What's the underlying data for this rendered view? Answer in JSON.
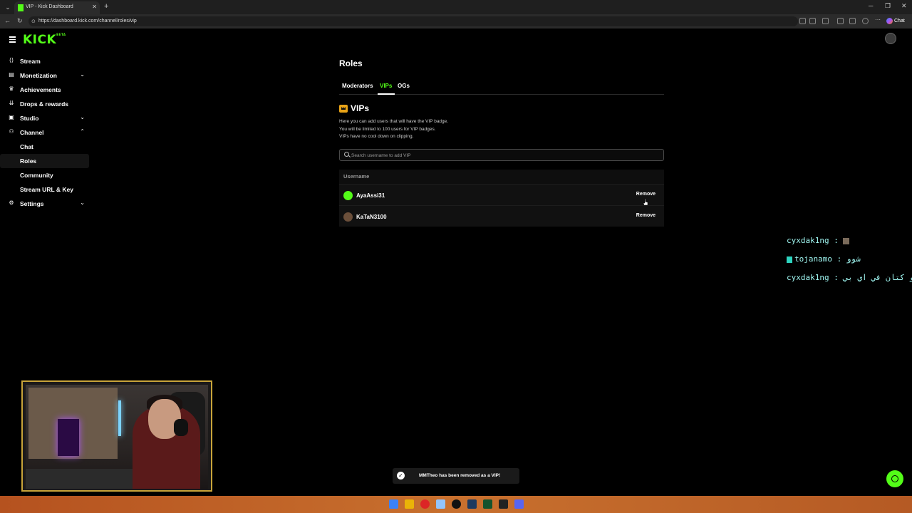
{
  "browser": {
    "tab_title": "VIP - Kick Dashboard",
    "url": "https://dashboard.kick.com/channel/roles/vip",
    "chat_button": "Chat"
  },
  "app": {
    "logo": "KICK",
    "logo_sup": "BETA"
  },
  "sidebar": {
    "items": [
      {
        "label": "Stream",
        "icon": "stream-icon"
      },
      {
        "label": "Monetization",
        "icon": "monetization-icon",
        "expandable": true
      },
      {
        "label": "Achievements",
        "icon": "trophy-icon"
      },
      {
        "label": "Drops & rewards",
        "icon": "drops-icon"
      },
      {
        "label": "Studio",
        "icon": "studio-icon",
        "expandable": true
      },
      {
        "label": "Channel",
        "icon": "channel-icon",
        "expanded": true
      },
      {
        "label": "Chat"
      },
      {
        "label": "Roles",
        "selected": true
      },
      {
        "label": "Community"
      },
      {
        "label": "Stream URL & Key"
      },
      {
        "label": "Settings",
        "icon": "gear-icon",
        "expandable": true
      }
    ]
  },
  "main": {
    "page_title": "Roles",
    "tabs": [
      {
        "label": "Moderators"
      },
      {
        "label": "VIPs",
        "active": true
      },
      {
        "label": "OGs"
      }
    ],
    "vip_heading": "VIPs",
    "description": [
      "Here you can add users that will have the VIP badge.",
      "You will be limited to 100 users for VIP badges.",
      "VIPs have no cool down on clipping."
    ],
    "search_placeholder": "Search username to add VIP",
    "table": {
      "header": "Username",
      "rows": [
        {
          "username": "AyaAssi31",
          "action": "Remove"
        },
        {
          "username": "KaTaN3100",
          "action": "Remove"
        }
      ]
    }
  },
  "overlay_chat": [
    {
      "user": "cyxdak1ng",
      "text": ""
    },
    {
      "user": "tojanamo",
      "text": "شوو"
    },
    {
      "user": "cyxdak1ng",
      "text": "ليش ثيو و كتان في اي بي"
    }
  ],
  "toast": {
    "message": "MMTheo has been removed as a VIP!"
  },
  "colors": {
    "accent": "#53fc18",
    "background": "#000000",
    "row_bg": "#111111"
  }
}
